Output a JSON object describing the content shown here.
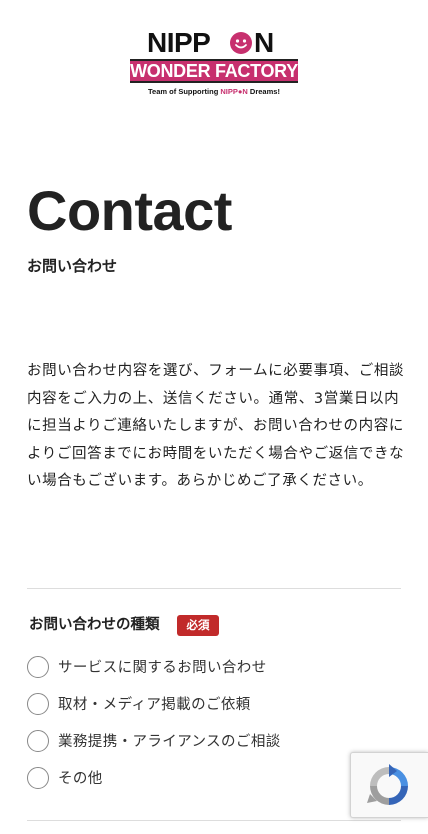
{
  "logo": {
    "word_nipp": "NIPP",
    "word_n": "N",
    "bar_text": "WONDER FACTORY",
    "tagline_before": "Team of Supporting ",
    "tagline_accent": "NIPP●N",
    "tagline_after": " Dreams!"
  },
  "page": {
    "title": "Contact",
    "subtitle": "お問い合わせ",
    "intro": "お問い合わせ内容を選び、フォームに必要事項、ご相談内容をご入力の上、送信ください。通常、3営業日以内に担当よりご連絡いたしますが、お問い合わせの内容によりご回答までにお時間をいただく場合やご返信できない場合もございます。あらかじめご了承ください。"
  },
  "form": {
    "inquiry_type": {
      "label": "お問い合わせの種類",
      "required_badge": "必須",
      "options": [
        {
          "label": "サービスに関するお問い合わせ",
          "selected": false
        },
        {
          "label": "取材・メディア掲載のご依頼",
          "selected": false
        },
        {
          "label": "業務提携・アライアンスのご相談",
          "selected": false
        },
        {
          "label": "その他",
          "selected": false
        }
      ]
    }
  },
  "colors": {
    "brand_pink": "#c7306e",
    "required_red": "#c12a2a",
    "text": "#222222",
    "divider": "#dddddd"
  },
  "icons": {
    "recaptcha": "recaptcha-icon",
    "logo_face": "smiley-face-icon"
  }
}
